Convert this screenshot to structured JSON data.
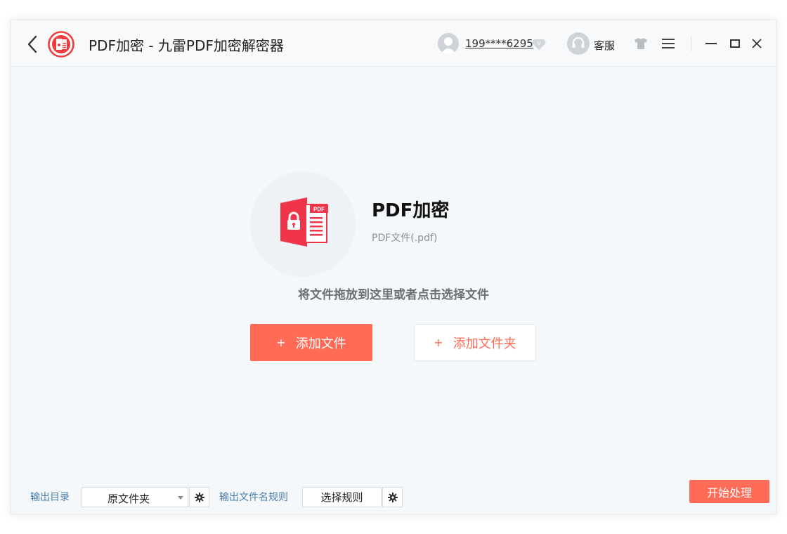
{
  "window": {
    "title": "PDF加密 - 九雷PDF加密解密器"
  },
  "header": {
    "user_phone": "199****6295",
    "service_label": "客服",
    "icons": [
      "back-icon",
      "app-logo-icon",
      "avatar-icon",
      "vip-diamond-icon",
      "headset-icon",
      "skin-tshirt-icon",
      "menu-icon",
      "minimize-icon",
      "maximize-icon",
      "close-icon"
    ]
  },
  "main": {
    "hero_title": "PDF加密",
    "hero_subtitle": "PDF文件(.pdf)",
    "drop_hint": "将文件拖放到这里或者点击选择文件",
    "add_file_plus": "+",
    "add_file_label": "添加文件",
    "add_folder_plus": "+",
    "add_folder_label": "添加文件夹"
  },
  "footer": {
    "output_dir_label": "输出目录",
    "output_dir_value": "原文件夹",
    "filename_rule_label": "输出文件名规则",
    "filename_rule_button": "选择规则",
    "start_button": "开始处理"
  },
  "colors": {
    "accent": "#ff6b57",
    "link_label": "#4a7fb0",
    "background": "#f5f8fa"
  }
}
